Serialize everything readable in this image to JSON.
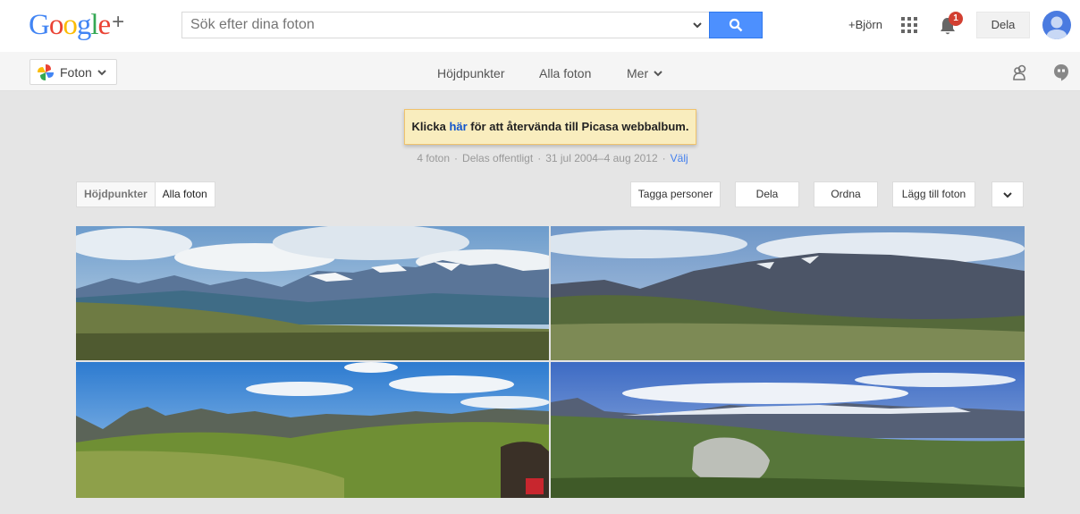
{
  "header": {
    "logo_google": "Google",
    "logo_plus": "+",
    "search_placeholder": "Sök efter dina foton",
    "user_link": "+Björn",
    "notification_count": "1",
    "share_label": "Dela"
  },
  "subnav": {
    "app_label": "Foton",
    "tabs": [
      "Höjdpunkter",
      "Alla foton",
      "Mer"
    ]
  },
  "banner": {
    "prefix": "Klicka ",
    "link": "här",
    "suffix": " för att återvända till Picasa webbalbum."
  },
  "album_meta": {
    "count": "4 foton",
    "sharing": "Delas offentligt",
    "date_range": "31 jul 2004–4 aug 2012",
    "select": "Välj"
  },
  "view_toggle": {
    "highlights": "Höjdpunkter",
    "all": "Alla foton"
  },
  "actions": {
    "tag_people": "Tagga personer",
    "share": "Dela",
    "arrange": "Ordna",
    "add_photos": "Lägg till foton"
  },
  "photos": [
    {
      "name": "mountain-panorama-1",
      "sky": "#8fb3d6",
      "ground": "#6f7a45"
    },
    {
      "name": "mountain-panorama-2",
      "sky": "#7fa3cf",
      "ground": "#556b3a"
    },
    {
      "name": "mountain-panorama-3",
      "sky": "#3f86d3",
      "ground": "#7f9a3f"
    },
    {
      "name": "mountain-panorama-4",
      "sky": "#4c74c9",
      "ground": "#5c7a35"
    }
  ]
}
